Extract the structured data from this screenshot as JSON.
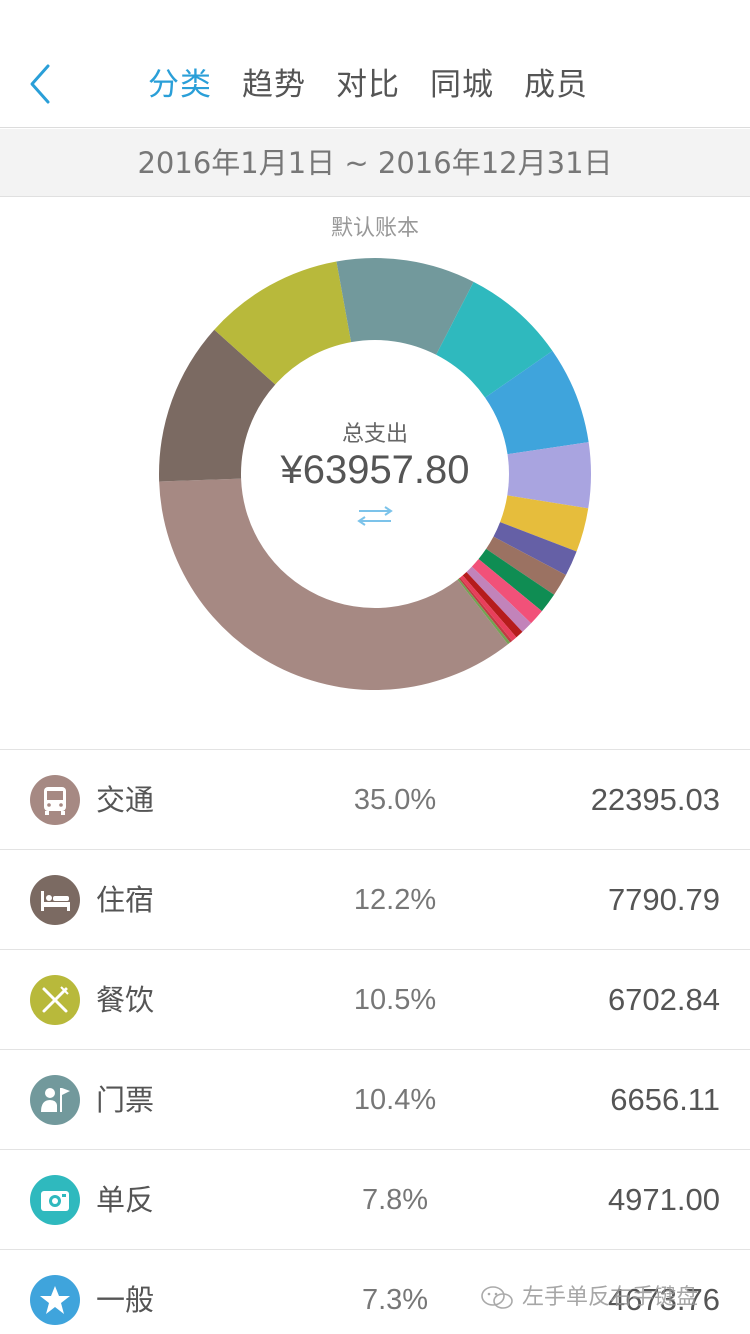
{
  "nav": {
    "tabs": [
      {
        "label": "分类",
        "active": true
      },
      {
        "label": "趋势",
        "active": false
      },
      {
        "label": "对比",
        "active": false
      },
      {
        "label": "同城",
        "active": false
      },
      {
        "label": "成员",
        "active": false
      }
    ]
  },
  "date_range": "2016年1月1日 ~ 2016年12月31日",
  "book_name": "默认账本",
  "summary": {
    "label": "总支出",
    "amount": "¥63957.80"
  },
  "colors": {
    "accent": "#2a9fd8"
  },
  "chart_data": {
    "type": "pie",
    "donut": true,
    "slices": [
      {
        "name": "交通",
        "percent": 35.0,
        "value": 22395.03,
        "color": "#a68983"
      },
      {
        "name": "住宿",
        "percent": 12.2,
        "value": 7790.79,
        "color": "#7b6a62"
      },
      {
        "name": "餐饮",
        "percent": 10.5,
        "value": 6702.84,
        "color": "#b8b93b"
      },
      {
        "name": "门票",
        "percent": 10.4,
        "value": 6656.11,
        "color": "#72999c"
      },
      {
        "name": "单反",
        "percent": 7.8,
        "value": 4971.0,
        "color": "#2fb9be"
      },
      {
        "name": "一般",
        "percent": 7.3,
        "value": 4673.76,
        "color": "#3fa4dc"
      },
      {
        "percent": 4.9,
        "color": "#a9a4e0"
      },
      {
        "percent": 3.3,
        "color": "#e6bd3c"
      },
      {
        "percent": 1.9,
        "color": "#6560a6"
      },
      {
        "percent": 1.7,
        "color": "#9b7262"
      },
      {
        "percent": 1.5,
        "color": "#0f8d53"
      },
      {
        "percent": 1.2,
        "color": "#f15179"
      },
      {
        "percent": 0.9,
        "color": "#c283ba"
      },
      {
        "percent": 0.6,
        "color": "#b61c1c"
      },
      {
        "percent": 0.4,
        "color": "#e83f5b"
      },
      {
        "percent": 0.2,
        "color": "#c03b43"
      },
      {
        "percent": 0.2,
        "color": "#73a254"
      }
    ]
  },
  "categories": [
    {
      "name": "交通",
      "percent": "35.0%",
      "amount": "22395.03",
      "icon": "bus-icon",
      "color": "#a68983"
    },
    {
      "name": "住宿",
      "percent": "12.2%",
      "amount": "7790.79",
      "icon": "bed-icon",
      "color": "#7b6a62"
    },
    {
      "name": "餐饮",
      "percent": "10.5%",
      "amount": "6702.84",
      "icon": "fork-knife-icon",
      "color": "#b8b93b"
    },
    {
      "name": "门票",
      "percent": "10.4%",
      "amount": "6656.11",
      "icon": "ticket-person-flag-icon",
      "color": "#72999c"
    },
    {
      "name": "单反",
      "percent": "7.8%",
      "amount": "4971.00",
      "icon": "camera-icon",
      "color": "#2fb9be"
    },
    {
      "name": "一般",
      "percent": "7.3%",
      "amount": "4673.76",
      "icon": "star-icon",
      "color": "#3fa4dc"
    }
  ],
  "watermark": "左手单反右手键盘"
}
